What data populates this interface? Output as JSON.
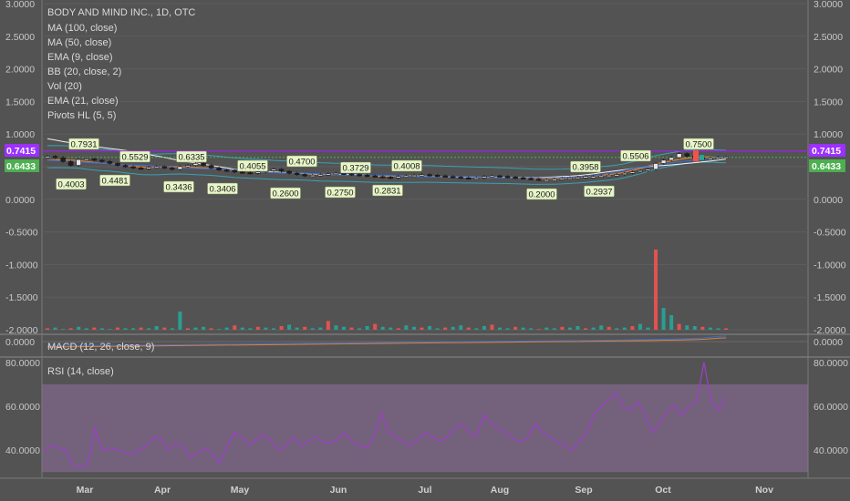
{
  "header": {
    "title": "BODY AND MIND INC., 1D, OTC",
    "indicators": [
      "MA (100, close)",
      "MA (50, close)",
      "EMA (9, close)",
      "BB (20, close, 2)",
      "Vol (20)",
      "EMA (21, close)",
      "Pivots HL (5, 5)"
    ]
  },
  "price_badges": {
    "upper": {
      "label": "0.7415",
      "color": "#9b30ff"
    },
    "lower": {
      "label": "0.6433",
      "color": "#4caf50"
    }
  },
  "colors": {
    "background": "#535353",
    "up_candle": "#26a69a",
    "down_candle": "#ef5350",
    "rsi_line": "#9c3fc6",
    "rsi_band": "#8f6f9e",
    "accent_line": "#a020f0"
  },
  "macd_label": "MACD (12, 26, close, 9)",
  "rsi_label": "RSI (14, close)",
  "chart_data": [
    {
      "type": "line",
      "title": "BODY AND MIND INC., 1D, OTC",
      "x_labels": [
        "Mar",
        "Apr",
        "May",
        "Jun",
        "Jul",
        "Aug",
        "Sep",
        "Oct",
        "Nov"
      ],
      "y_ticks": [
        "3.0000",
        "2.5000",
        "2.0000",
        "1.5000",
        "1.0000",
        "0.5000",
        "0.0000",
        "-0.5000",
        "-1.0000",
        "-1.5000",
        "-2.0000"
      ],
      "ylim": [
        -2.0,
        3.0
      ],
      "close_series": [
        0.66,
        0.64,
        0.58,
        0.52,
        0.61,
        0.62,
        0.6,
        0.58,
        0.55,
        0.52,
        0.5,
        0.48,
        0.47,
        0.49,
        0.5,
        0.48,
        0.46,
        0.5,
        0.52,
        0.55,
        0.52,
        0.48,
        0.45,
        0.44,
        0.42,
        0.41,
        0.4,
        0.42,
        0.44,
        0.46,
        0.43,
        0.4,
        0.38,
        0.36,
        0.37,
        0.38,
        0.39,
        0.4,
        0.39,
        0.38,
        0.37,
        0.36,
        0.35,
        0.34,
        0.33,
        0.35,
        0.36,
        0.37,
        0.38,
        0.37,
        0.36,
        0.35,
        0.34,
        0.33,
        0.32,
        0.33,
        0.35,
        0.36,
        0.35,
        0.34,
        0.33,
        0.32,
        0.31,
        0.3,
        0.3,
        0.31,
        0.32,
        0.33,
        0.34,
        0.35,
        0.35,
        0.36,
        0.37,
        0.38,
        0.4,
        0.42,
        0.44,
        0.46,
        0.55,
        0.6,
        0.64,
        0.7,
        0.66,
        0.64,
        0.62,
        0.63,
        0.64,
        0.65
      ],
      "pivots": [
        {
          "label": "0.7931",
          "value": 0.7931,
          "kind": "high"
        },
        {
          "label": "0.4003",
          "value": 0.4003,
          "kind": "low"
        },
        {
          "label": "0.4481",
          "value": 0.4481,
          "kind": "low"
        },
        {
          "label": "0.5529",
          "value": 0.5529,
          "kind": "high"
        },
        {
          "label": "0.6335",
          "value": 0.6335,
          "kind": "high"
        },
        {
          "label": "0.3436",
          "value": 0.3436,
          "kind": "low"
        },
        {
          "label": "0.3406",
          "value": 0.3406,
          "kind": "low"
        },
        {
          "label": "0.4055",
          "value": 0.4055,
          "kind": "high"
        },
        {
          "label": "0.2600",
          "value": 0.26,
          "kind": "low"
        },
        {
          "label": "0.4700",
          "value": 0.47,
          "kind": "high"
        },
        {
          "label": "0.3729",
          "value": 0.3729,
          "kind": "high"
        },
        {
          "label": "0.2750",
          "value": 0.275,
          "kind": "low"
        },
        {
          "label": "0.2831",
          "value": 0.2831,
          "kind": "low"
        },
        {
          "label": "0.4008",
          "value": 0.4008,
          "kind": "high"
        },
        {
          "label": "0.2000",
          "value": 0.2,
          "kind": "low"
        },
        {
          "label": "0.3958",
          "value": 0.3958,
          "kind": "high"
        },
        {
          "label": "0.2937",
          "value": 0.2937,
          "kind": "low"
        },
        {
          "label": "0.5506",
          "value": 0.5506,
          "kind": "high"
        },
        {
          "label": "0.7500",
          "value": 0.75,
          "kind": "high"
        }
      ],
      "current_price": 0.6433,
      "highlight_level": 0.7415
    },
    {
      "type": "bar",
      "title": "Vol (20)",
      "volumes": [
        2,
        3,
        1,
        2,
        4,
        2,
        3,
        2,
        1,
        3,
        2,
        2,
        3,
        2,
        5,
        3,
        2,
        25,
        2,
        3,
        4,
        2,
        1,
        3,
        6,
        3,
        2,
        4,
        3,
        2,
        5,
        7,
        3,
        4,
        2,
        3,
        12,
        6,
        4,
        3,
        2,
        5,
        8,
        4,
        3,
        2,
        6,
        4,
        3,
        5,
        2,
        3,
        4,
        6,
        3,
        2,
        5,
        7,
        3,
        2,
        4,
        3,
        2,
        1,
        3,
        2,
        4,
        3,
        5,
        2,
        3,
        6,
        4,
        2,
        3,
        5,
        8,
        3,
        110,
        30,
        20,
        8,
        6,
        5,
        4,
        3,
        2,
        2
      ]
    },
    {
      "type": "line",
      "title": "MACD (12, 26, close, 9)",
      "y_ticks": [
        "0.0000"
      ]
    },
    {
      "type": "line",
      "title": "RSI (14, close)",
      "y_ticks": [
        "80.0000",
        "60.0000",
        "40.0000"
      ],
      "ylim": [
        28,
        82
      ],
      "band": [
        30,
        70
      ],
      "values": [
        40,
        42,
        41,
        40,
        33,
        32,
        34,
        50,
        40,
        41,
        40,
        39,
        38,
        40,
        42,
        46,
        45,
        40,
        43,
        42,
        36,
        39,
        41,
        38,
        34,
        42,
        48,
        46,
        42,
        45,
        47,
        44,
        40,
        42,
        46,
        42,
        44,
        46,
        44,
        43,
        45,
        48,
        44,
        42,
        41,
        46,
        57,
        48,
        46,
        44,
        42,
        45,
        48,
        46,
        44,
        46,
        50,
        52,
        48,
        46,
        56,
        52,
        50,
        48,
        45,
        44,
        46,
        52,
        48,
        46,
        44,
        42,
        40,
        44,
        48,
        56,
        60,
        63,
        66,
        60,
        58,
        62,
        56,
        48,
        52,
        58,
        60,
        56,
        60,
        62,
        80,
        62,
        58,
        64
      ]
    }
  ]
}
